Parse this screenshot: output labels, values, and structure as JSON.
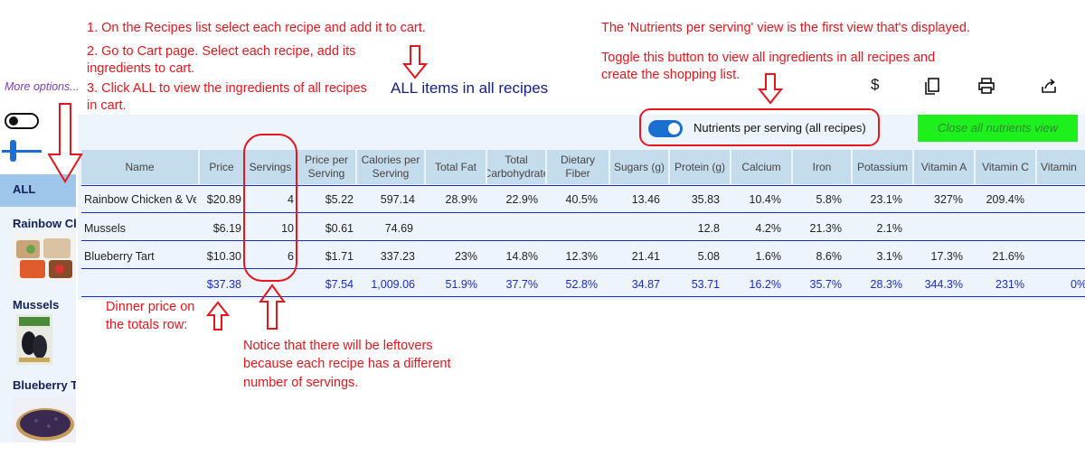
{
  "instructions": {
    "line1": "1. On the Recipes list select each recipe and add it to cart.",
    "line2a": "2. Go to Cart page. Select each recipe, add its",
    "line2b": "ingredients to cart.",
    "line3a": "3. Click ALL to view the ingredients of all recipes",
    "line3b": "in cart.",
    "nutrients_first": "The 'Nutrients per serving' view is the first view that's displayed.",
    "toggle_line1": "Toggle this button to view all ingredients in all recipes and",
    "toggle_line2": "create the shopping list.",
    "dinner_line1": "Dinner price on",
    "dinner_line2": "the totals row:",
    "leftover_line1": "Notice that there will be leftovers",
    "leftover_line2": "because each recipe has a different",
    "leftover_line3": "number of servings."
  },
  "header": {
    "more_options": "More options...",
    "title": "ALL items in all recipes"
  },
  "toolbar": {
    "dollar": "$",
    "copy_icon": "copy-icon",
    "print_icon": "print-icon",
    "share_icon": "share-icon"
  },
  "toggle": {
    "label": "Nutrients per serving (all recipes)",
    "on": true
  },
  "close_button": "Close all nutrients view",
  "sidebar": {
    "all_label": "ALL",
    "recipes": [
      {
        "name": "Rainbow Chicken & Veggies"
      },
      {
        "name": "Mussels"
      },
      {
        "name": "Blueberry Tart"
      }
    ]
  },
  "table": {
    "columns": [
      "Name",
      "Price",
      "Servings",
      "Price per Serving",
      "Calories per Serving",
      "Total Fat",
      "Total Carbohydrate",
      "Dietary Fiber",
      "Sugars (g)",
      "Protein (g)",
      "Calcium",
      "Iron",
      "Potassium",
      "Vitamin A",
      "Vitamin C",
      "Vitamin"
    ],
    "rows": [
      [
        "Rainbow Chicken & Veggies",
        "$20.89",
        "4",
        "$5.22",
        "597.14",
        "28.9%",
        "22.9%",
        "40.5%",
        "13.46",
        "35.83",
        "10.4%",
        "5.8%",
        "23.1%",
        "327%",
        "209.4%",
        ""
      ],
      [
        "Mussels",
        "$6.19",
        "10",
        "$0.61",
        "74.69",
        "",
        "",
        "",
        "",
        "12.8",
        "4.2%",
        "21.3%",
        "2.1%",
        "",
        "",
        ""
      ],
      [
        "Blueberry Tart",
        "$10.30",
        "6",
        "$1.71",
        "337.23",
        "23%",
        "14.8%",
        "12.3%",
        "21.41",
        "5.08",
        "1.6%",
        "8.6%",
        "3.1%",
        "17.3%",
        "21.6%",
        ""
      ]
    ],
    "totals": [
      "",
      "$37.38",
      "",
      "$7.54",
      "1,009.06",
      "51.9%",
      "37.7%",
      "52.8%",
      "34.87",
      "53.71",
      "16.2%",
      "35.7%",
      "28.3%",
      "344.3%",
      "231%",
      "0%"
    ]
  },
  "colors": {
    "annotation": "#e8161c",
    "accent": "#1a6fd1",
    "totals": "#1a2bd4",
    "header_bg": "#c5dced",
    "close_button": "#1df01d"
  }
}
